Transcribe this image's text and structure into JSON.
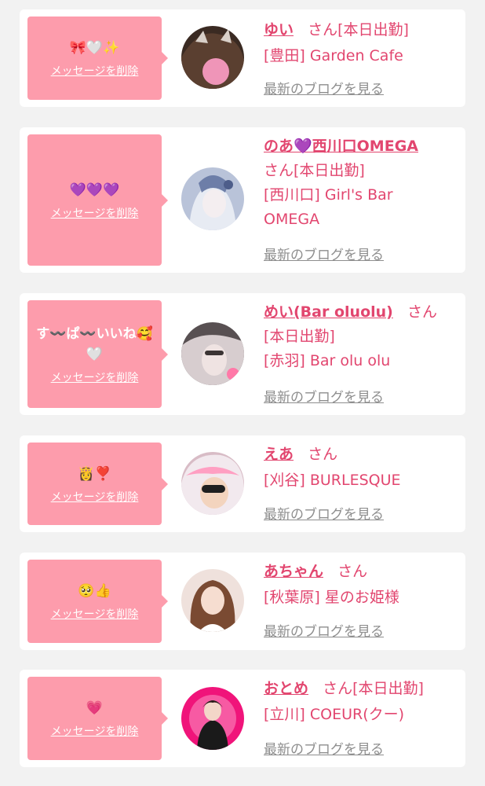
{
  "entries": [
    {
      "message": "🎀🤍✨",
      "delete_label": "メッセージを削除",
      "name": "ゆい",
      "suffix": "さん[本日出勤]",
      "shop": "[豊田] Garden Cafe",
      "blog_label": "最新のブログを見る"
    },
    {
      "message": "💜💜💜",
      "delete_label": "メッセージを削除",
      "name": "のあ💜西川口OMEGA",
      "suffix": "さん[本日出勤]",
      "shop": "[西川口] Girl's Bar OMEGA",
      "blog_label": "最新のブログを見る"
    },
    {
      "message": "す〰️ぱ〰️いいね🥰🤍",
      "delete_label": "メッセージを削除",
      "name": "めい(Bar oluolu)",
      "suffix": "さん",
      "suffix2": "[本日出勤]",
      "shop": "[赤羽] Bar olu olu",
      "blog_label": "最新のブログを見る"
    },
    {
      "message": "👸❣️",
      "delete_label": "メッセージを削除",
      "name": "えあ",
      "suffix": "さん",
      "shop": "[刈谷] BURLESQUE",
      "blog_label": "最新のブログを見る"
    },
    {
      "message": "🥺👍",
      "delete_label": "メッセージを削除",
      "name": "あちゃん",
      "suffix": "さん",
      "shop": "[秋葉原] 星のお姫様",
      "blog_label": "最新のブログを見る"
    },
    {
      "message": "💗",
      "delete_label": "メッセージを削除",
      "name": "おとめ",
      "suffix": "さん[本日出勤]",
      "shop": "[立川] COEUR(クー)",
      "blog_label": "最新のブログを見る"
    }
  ],
  "colors": {
    "bubble": "#fd9cac",
    "name": "#e2466f",
    "link_gray": "#8e8e8e",
    "background": "#f2f2f2"
  }
}
